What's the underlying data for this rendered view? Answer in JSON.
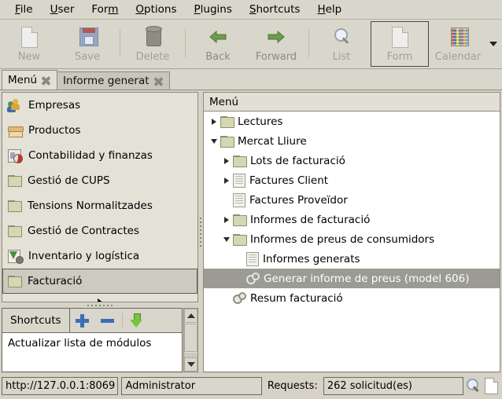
{
  "menubar": {
    "items": [
      {
        "label": "File",
        "mnemonic": "F"
      },
      {
        "label": "User",
        "mnemonic": "U"
      },
      {
        "label": "Form",
        "mnemonic": "m"
      },
      {
        "label": "Options",
        "mnemonic": "O"
      },
      {
        "label": "Plugins",
        "mnemonic": "P"
      },
      {
        "label": "Shortcuts",
        "mnemonic": "S"
      },
      {
        "label": "Help",
        "mnemonic": "H"
      }
    ]
  },
  "toolbar": {
    "buttons": [
      {
        "label": "New",
        "icon": "new-page-icon",
        "enabled": false,
        "active": false
      },
      {
        "label": "Save",
        "icon": "floppy-disk-icon",
        "enabled": false,
        "active": false
      },
      {
        "label": "Delete",
        "icon": "trash-can-icon",
        "enabled": false,
        "active": false
      },
      {
        "label": "Back",
        "icon": "arrow-left-icon",
        "enabled": true,
        "active": false
      },
      {
        "label": "Forward",
        "icon": "arrow-right-icon",
        "enabled": true,
        "active": false
      },
      {
        "label": "List",
        "icon": "magnifier-icon",
        "enabled": false,
        "active": false
      },
      {
        "label": "Form",
        "icon": "form-page-icon",
        "enabled": false,
        "active": true
      },
      {
        "label": "Calendar",
        "icon": "calendar-icon",
        "enabled": false,
        "active": false
      }
    ],
    "overflow_icon": "chevron-down-icon"
  },
  "tabs": [
    {
      "label": "Menú",
      "selected": true,
      "close_icon": "close-icon"
    },
    {
      "label": "Informe generat",
      "selected": false,
      "close_icon": "close-icon"
    }
  ],
  "sidebar": {
    "items": [
      {
        "label": "Empresas",
        "icon": "users-icon",
        "selected": false
      },
      {
        "label": "Productos",
        "icon": "box-icon",
        "selected": false
      },
      {
        "label": "Contabilidad y finanzas",
        "icon": "chart-pie-icon",
        "selected": false
      },
      {
        "label": "Gestió de CUPS",
        "icon": "folder-icon",
        "selected": false
      },
      {
        "label": "Tensions Normalitzades",
        "icon": "folder-icon",
        "selected": false
      },
      {
        "label": "Gestió de Contractes",
        "icon": "folder-icon",
        "selected": false
      },
      {
        "label": "Inventario y logística",
        "icon": "inventory-icon",
        "selected": false
      },
      {
        "label": "Facturació",
        "icon": "folder-icon",
        "selected": true
      }
    ],
    "scroll_more_icon": "triangle-right-icon"
  },
  "shortcuts": {
    "title": "Shortcuts",
    "add_icon": "plus-icon",
    "remove_icon": "minus-icon",
    "download_icon": "download-arrow-icon",
    "items": [
      "Actualizar lista de módulos"
    ],
    "scrollbar": {
      "up_icon": "triangle-up-icon",
      "down_icon": "triangle-down-icon"
    }
  },
  "tree": {
    "header": "Menú",
    "nodes": [
      {
        "label": "Lectures",
        "icon": "folder-icon",
        "indent": 0,
        "twisty": "collapsed",
        "selected": false
      },
      {
        "label": "Mercat Lliure",
        "icon": "folder-icon",
        "indent": 0,
        "twisty": "expanded",
        "selected": false
      },
      {
        "label": "Lots de facturació",
        "icon": "folder-icon",
        "indent": 1,
        "twisty": "collapsed",
        "selected": false
      },
      {
        "label": "Factures Client",
        "icon": "document-icon",
        "indent": 1,
        "twisty": "collapsed",
        "selected": false
      },
      {
        "label": "Factures Proveïdor",
        "icon": "document-icon",
        "indent": 1,
        "twisty": "none",
        "selected": false
      },
      {
        "label": "Informes de facturació",
        "icon": "folder-icon",
        "indent": 1,
        "twisty": "collapsed",
        "selected": false
      },
      {
        "label": "Informes de preus de consumidors",
        "icon": "folder-icon",
        "indent": 1,
        "twisty": "expanded",
        "selected": false
      },
      {
        "label": "Informes generats",
        "icon": "document-icon",
        "indent": 2,
        "twisty": "none",
        "selected": false
      },
      {
        "label": "Generar informe de preus (model 606)",
        "icon": "gears-icon",
        "indent": 2,
        "twisty": "none",
        "selected": true
      },
      {
        "label": "Resum facturació",
        "icon": "gears-icon",
        "indent": 1,
        "twisty": "none",
        "selected": false
      }
    ]
  },
  "status": {
    "url": "http://127.0.0.1:8069 ...",
    "user": "Administrator",
    "requests_label": "Requests:",
    "requests_value": "262 solicitud(es)",
    "search_icon": "magnifier-icon",
    "page_icon": "page-icon"
  },
  "colors": {
    "window_bg": "#d6d2c7",
    "panel_bg": "#d9d6cb",
    "tree_selection": "#9b9b93",
    "list_selection": "#cdcabf",
    "accent_blue": "#3b6fb5",
    "accent_green": "#7cc141"
  }
}
